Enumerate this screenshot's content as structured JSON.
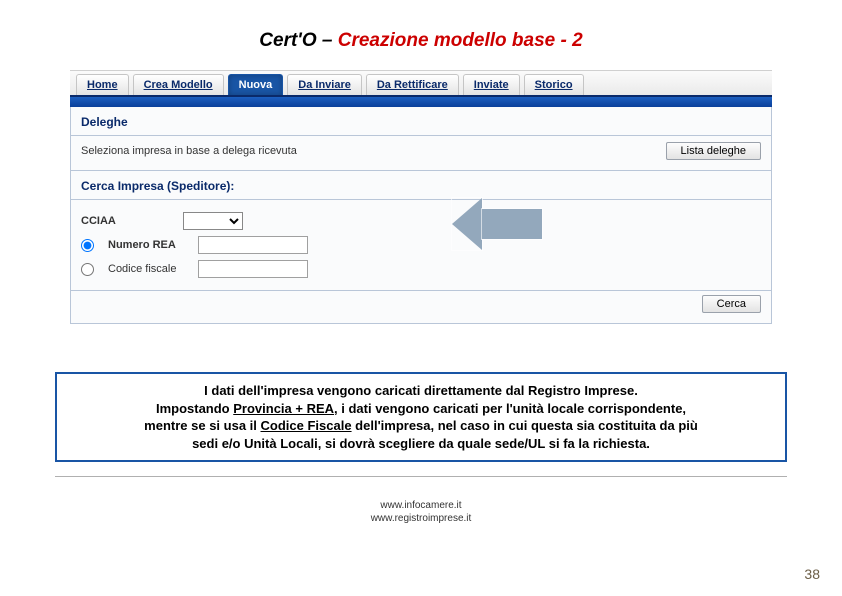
{
  "title": {
    "black": "Cert'O – ",
    "red": "Creazione modello base - 2"
  },
  "tabs": {
    "items": [
      {
        "label": "Home",
        "active": false,
        "underlined": true
      },
      {
        "label": "Crea Modello",
        "active": false,
        "underlined": true
      },
      {
        "label": "Nuova",
        "active": true,
        "underlined": false
      },
      {
        "label": "Da Inviare",
        "active": false,
        "underlined": true
      },
      {
        "label": "Da Rettificare",
        "active": false,
        "underlined": true
      },
      {
        "label": "Inviate",
        "active": false,
        "underlined": true
      },
      {
        "label": "Storico",
        "active": false,
        "underlined": true
      }
    ]
  },
  "deleghe": {
    "heading": "Deleghe",
    "hint": "Seleziona impresa in base a delega ricevuta",
    "button": "Lista deleghe"
  },
  "cerca": {
    "heading": "Cerca Impresa (Speditore):",
    "cciaa_label": "CCIAA",
    "cciaa_value": "",
    "numero_rea_label": "Numero REA",
    "numero_rea_value": "",
    "codice_fiscale_label": "Codice fiscale",
    "codice_fiscale_value": "",
    "search_button": "Cerca",
    "radio_selected": "numero_rea"
  },
  "info_box": {
    "l1": "I dati dell'impresa vengono caricati direttamente dal Registro Imprese.",
    "l2a": "Impostando ",
    "l2b_ul": "Provincia + REA",
    "l2c": ", i dati vengono caricati per l'unità locale corrispondente,",
    "l3a": "mentre se si usa il ",
    "l3b_ul": "Codice Fiscale",
    "l3c": " dell'impresa, nel caso in cui questa sia costituita da più",
    "l4": "sedi e/o Unità Locali, si dovrà scegliere da quale sede/UL si fa la richiesta."
  },
  "footer": {
    "line1": "www.infocamere.it",
    "line2": "www.registroimprese.it"
  },
  "page_number": "38"
}
